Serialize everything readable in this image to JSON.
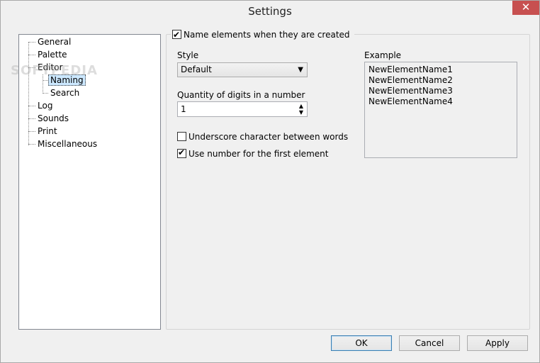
{
  "window": {
    "title": "Settings",
    "close_glyph": "✕"
  },
  "tree": {
    "items": [
      {
        "label": "General"
      },
      {
        "label": "Palette"
      },
      {
        "label": "Editor"
      },
      {
        "label": "Naming"
      },
      {
        "label": "Search"
      },
      {
        "label": "Log"
      },
      {
        "label": "Sounds"
      },
      {
        "label": "Print"
      },
      {
        "label": "Miscellaneous"
      }
    ],
    "selected": "Naming"
  },
  "naming": {
    "group_checkbox_label": "Name elements when they are created",
    "group_checked": true,
    "style_label": "Style",
    "style_value": "Default",
    "digits_label": "Quantity of digits in a number",
    "digits_value": "1",
    "underscore_label": "Underscore character between words",
    "underscore_checked": false,
    "first_number_label": "Use number for the first element",
    "first_number_checked": true,
    "example_label": "Example",
    "example_lines": [
      "NewElementName1",
      "NewElementName2",
      "NewElementName3",
      "NewElementName4"
    ]
  },
  "buttons": {
    "ok": "OK",
    "cancel": "Cancel",
    "apply": "Apply"
  },
  "watermark": "SOFTPEDIA"
}
